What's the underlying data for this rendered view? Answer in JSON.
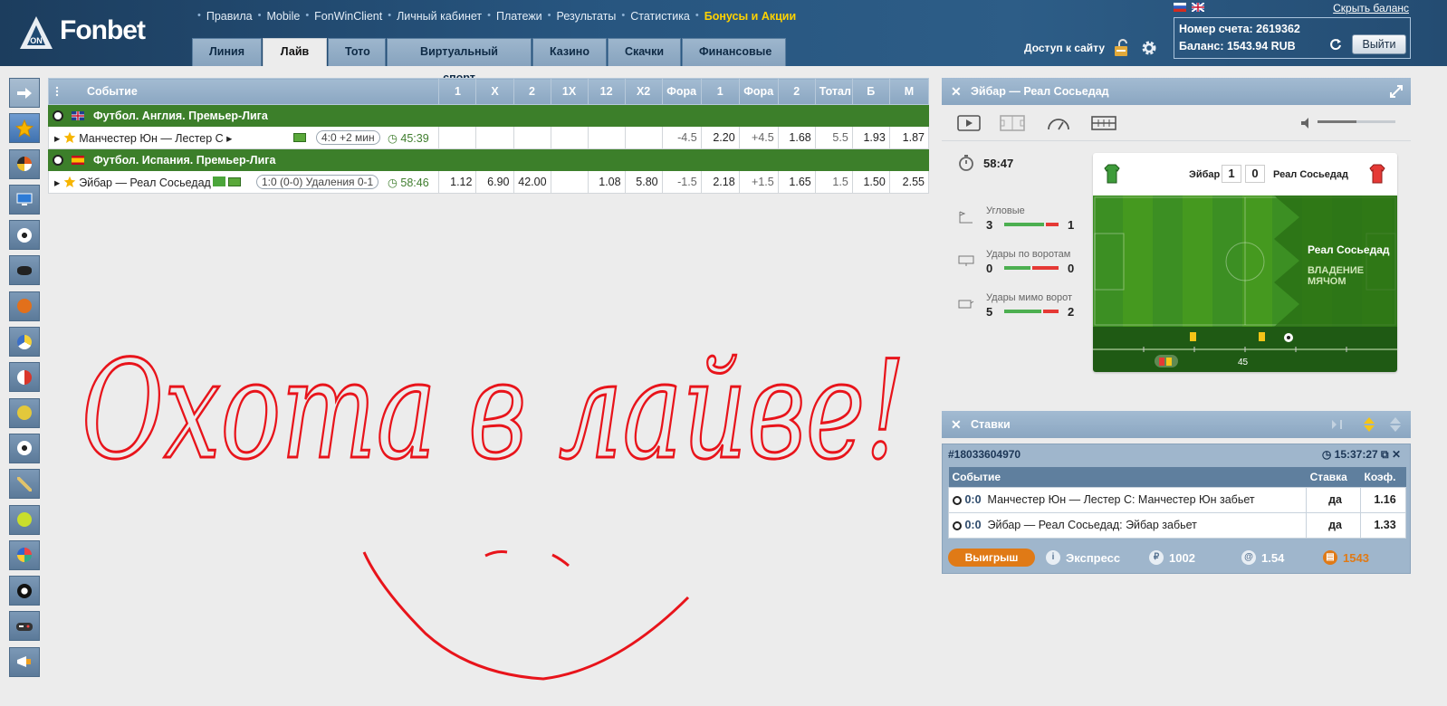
{
  "header": {
    "logo_text": "Fonbet",
    "nav": [
      "Правила",
      "Mobile",
      "FonWinClient",
      "Личный кабинет",
      "Платежи",
      "Результаты",
      "Статистика"
    ],
    "promo": "Бонусы и Акции",
    "tabs": [
      "Линия",
      "Лайв",
      "Тото",
      "Виртуальный спорт",
      "Казино",
      "Скачки",
      "Финансовые"
    ],
    "active_tab": "Лайв",
    "site_access": "Доступ к сайту",
    "hide_balance": "Скрыть баланс",
    "account_label": "Номер счета: 2619362",
    "balance_label": "Баланс: 1543.94 RUB",
    "logout": "Выйти"
  },
  "sports_bar": [
    "arrow-right-icon",
    "star-icon",
    "all-sports-icon",
    "tv-icon",
    "football-icon",
    "hockey-icon",
    "basketball-icon",
    "volleyball-icon",
    "sport-mixed-icon",
    "tennis-icon",
    "football-2-icon",
    "baseball-icon",
    "tennis-ball-icon",
    "handball-icon",
    "billiards-icon",
    "esports-icon",
    "promo-icon"
  ],
  "events_table": {
    "headers": [
      "Событие",
      "1",
      "X",
      "2",
      "1X",
      "12",
      "X2",
      "Фора",
      "1",
      "Фора",
      "2",
      "Тотал",
      "Б",
      "М"
    ],
    "leagues": [
      {
        "name": "Футбол. Англия. Премьер-Лига",
        "events": [
          {
            "name": "Манчестер Юн — Лестер С",
            "score": "4:0 +2 мин",
            "clock": "45:39",
            "odds": [
              "",
              "",
              "",
              "",
              "",
              "",
              "-4.5",
              "2.20",
              "+4.5",
              "1.68",
              "5.5",
              "1.93",
              "1.87"
            ]
          }
        ]
      },
      {
        "name": "Футбол. Испания. Премьер-Лига",
        "events": [
          {
            "name": "Эйбар — Реал Сосьедад",
            "score": "1:0 (0-0) Удаления 0-1",
            "clock": "58:46",
            "odds": [
              "1.12",
              "6.90",
              "42.00",
              "",
              "1.08",
              "5.80",
              "-1.5",
              "2.18",
              "+1.5",
              "1.65",
              "1.5",
              "1.50",
              "2.55"
            ]
          }
        ]
      }
    ]
  },
  "match_panel": {
    "title": "Эйбар — Реал Сосьедад",
    "timer": "58:47",
    "home": "Эйбар",
    "away": "Реал Сосьедад",
    "home_score": "1",
    "away_score": "0",
    "pitch_team": "Реал Сосьедад",
    "pitch_caption": "ВЛАДЕНИЕ МЯЧОМ",
    "timeline_minute": "45",
    "stats": [
      {
        "label": "Угловые",
        "home": "3",
        "away": "1",
        "home_share": 0.75
      },
      {
        "label": "Удары по воротам",
        "home": "0",
        "away": "0",
        "home_share": 0.5
      },
      {
        "label": "Удары мимо ворот",
        "home": "5",
        "away": "2",
        "home_share": 0.71
      }
    ],
    "colors": {
      "home": "#4caf50",
      "away": "#e53935"
    }
  },
  "bets_panel": {
    "title": "Ставки",
    "coupon_number": "#18033604970",
    "coupon_time": "15:37:27",
    "columns": [
      "Событие",
      "Ставка",
      "Коэф."
    ],
    "rows": [
      {
        "score": "0:0",
        "event": "Манчестер Юн — Лестер С: Манчестер Юн забьет",
        "stake": "да",
        "coef": "1.16"
      },
      {
        "score": "0:0",
        "event": "Эйбар — Реал Сосьедад: Эйбар забьет",
        "stake": "да",
        "coef": "1.33"
      }
    ],
    "win_button": "Выигрыш",
    "express": "Экспресс",
    "amount": "1002",
    "total_coef": "1.54",
    "win_amount": "1543"
  },
  "handwriting": "Охота в лайве!"
}
